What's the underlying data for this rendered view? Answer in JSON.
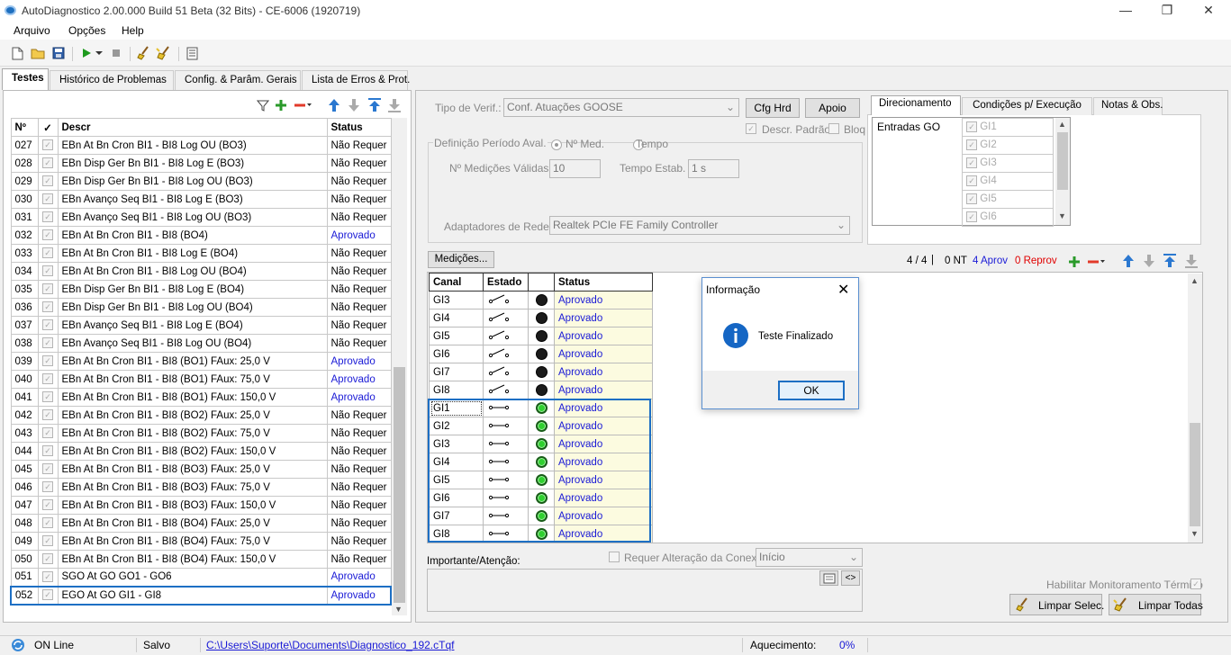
{
  "window": {
    "title": "AutoDiagnostico 2.00.000 Build 51 Beta (32 Bits) - CE-6006 (1920719)"
  },
  "menu": [
    "Arquivo",
    "Opções",
    "Help"
  ],
  "tabs": [
    "Testes",
    "Histórico de Problemas",
    "Config. & Parâm. Gerais",
    "Lista de Erros & Prot."
  ],
  "tests_table": {
    "headers": [
      "Nº",
      "✓",
      "Descr",
      "Status"
    ],
    "rows": [
      {
        "num": "027",
        "descr": "EBn At Bn Cron BI1 - BI8 Log OU (BO3)",
        "status": "Não Requer"
      },
      {
        "num": "028",
        "descr": "EBn Disp Ger Bn BI1 - BI8 Log E (BO3)",
        "status": "Não Requer"
      },
      {
        "num": "029",
        "descr": "EBn Disp Ger Bn BI1 - BI8 Log OU (BO3)",
        "status": "Não Requer"
      },
      {
        "num": "030",
        "descr": "EBn Avanço Seq BI1 - BI8 Log E (BO3)",
        "status": "Não Requer"
      },
      {
        "num": "031",
        "descr": "EBn Avanço Seq BI1 - BI8 Log OU (BO3)",
        "status": "Não Requer"
      },
      {
        "num": "032",
        "descr": "EBn At Bn Cron BI1 - BI8 (BO4)",
        "status": "Aprovado"
      },
      {
        "num": "033",
        "descr": "EBn At Bn Cron BI1 - BI8 Log E (BO4)",
        "status": "Não Requer"
      },
      {
        "num": "034",
        "descr": "EBn At Bn Cron BI1 - BI8 Log OU (BO4)",
        "status": "Não Requer"
      },
      {
        "num": "035",
        "descr": "EBn Disp Ger Bn BI1 - BI8 Log E (BO4)",
        "status": "Não Requer"
      },
      {
        "num": "036",
        "descr": "EBn Disp Ger Bn BI1 - BI8 Log OU (BO4)",
        "status": "Não Requer"
      },
      {
        "num": "037",
        "descr": "EBn Avanço Seq BI1 - BI8 Log E (BO4)",
        "status": "Não Requer"
      },
      {
        "num": "038",
        "descr": "EBn Avanço Seq BI1 - BI8 Log OU (BO4)",
        "status": "Não Requer"
      },
      {
        "num": "039",
        "descr": "EBn At Bn Cron BI1 - BI8 (BO1) FAux: 25,0 V",
        "status": "Aprovado"
      },
      {
        "num": "040",
        "descr": "EBn At Bn Cron BI1 - BI8 (BO1) FAux: 75,0 V",
        "status": "Aprovado"
      },
      {
        "num": "041",
        "descr": "EBn At Bn Cron BI1 - BI8 (BO1) FAux: 150,0 V",
        "status": "Aprovado"
      },
      {
        "num": "042",
        "descr": "EBn At Bn Cron BI1 - BI8 (BO2) FAux: 25,0 V",
        "status": "Não Requer"
      },
      {
        "num": "043",
        "descr": "EBn At Bn Cron BI1 - BI8 (BO2) FAux: 75,0 V",
        "status": "Não Requer"
      },
      {
        "num": "044",
        "descr": "EBn At Bn Cron BI1 - BI8 (BO2) FAux: 150,0 V",
        "status": "Não Requer"
      },
      {
        "num": "045",
        "descr": "EBn At Bn Cron BI1 - BI8 (BO3) FAux: 25,0 V",
        "status": "Não Requer"
      },
      {
        "num": "046",
        "descr": "EBn At Bn Cron BI1 - BI8 (BO3) FAux: 75,0 V",
        "status": "Não Requer"
      },
      {
        "num": "047",
        "descr": "EBn At Bn Cron BI1 - BI8 (BO3) FAux: 150,0 V",
        "status": "Não Requer"
      },
      {
        "num": "048",
        "descr": "EBn At Bn Cron BI1 - BI8 (BO4) FAux: 25,0 V",
        "status": "Não Requer"
      },
      {
        "num": "049",
        "descr": "EBn At Bn Cron BI1 - BI8 (BO4) FAux: 75,0 V",
        "status": "Não Requer"
      },
      {
        "num": "050",
        "descr": "EBn At Bn Cron BI1 - BI8 (BO4) FAux: 150,0 V",
        "status": "Não Requer"
      },
      {
        "num": "051",
        "descr": "SGO At GO GO1 - GO6",
        "status": "Aprovado"
      },
      {
        "num": "052",
        "descr": "EGO At GO GI1 - GI8",
        "status": "Aprovado"
      }
    ]
  },
  "config": {
    "tipo_label": "Tipo de Verif.:",
    "tipo_value": "Conf. Atuações GOOSE",
    "cfg_hrd": "Cfg Hrd",
    "apoio": "Apoio",
    "descr_padrao": "Descr. Padrão",
    "bloq": "Bloq",
    "periodo_label": "Definição Período Aval.",
    "radio_med": "Nº Med.",
    "radio_tempo": "Tempo",
    "medicoes_validas_label": "Nº Medições Válidas:",
    "medicoes_validas_value": "10",
    "tempo_estab_label": "Tempo Estab.",
    "tempo_estab_value": "1 s",
    "adaptadores_label": "Adaptadores de Rede:",
    "adaptadores_value": "Realtek PCIe FE Family Controller"
  },
  "right_tabs": [
    "Direcionamento",
    "Condições p/ Execução",
    "Notas & Obs."
  ],
  "direcionamento": {
    "label": "Entradas GO",
    "items": [
      "GI1",
      "GI2",
      "GI3",
      "GI4",
      "GI5",
      "GI6"
    ]
  },
  "medicoes": {
    "button": "Medições...",
    "counter": "4 / 4",
    "nt": "0 NT",
    "aprov": "4 Aprov",
    "reprov": "0 Reprov"
  },
  "channel_table": {
    "headers": [
      "Canal",
      "Estado",
      "",
      "Status"
    ],
    "rows": [
      {
        "canal": "GI3",
        "state": "off",
        "status": "Aprovado"
      },
      {
        "canal": "GI4",
        "state": "off",
        "status": "Aprovado"
      },
      {
        "canal": "GI5",
        "state": "off",
        "status": "Aprovado"
      },
      {
        "canal": "GI6",
        "state": "off",
        "status": "Aprovado"
      },
      {
        "canal": "GI7",
        "state": "off",
        "status": "Aprovado"
      },
      {
        "canal": "GI8",
        "state": "off",
        "status": "Aprovado"
      },
      {
        "canal": "GI1",
        "state": "on",
        "status": "Aprovado"
      },
      {
        "canal": "GI2",
        "state": "on",
        "status": "Aprovado"
      },
      {
        "canal": "GI3",
        "state": "on",
        "status": "Aprovado"
      },
      {
        "canal": "GI4",
        "state": "on",
        "status": "Aprovado"
      },
      {
        "canal": "GI5",
        "state": "on",
        "status": "Aprovado"
      },
      {
        "canal": "GI6",
        "state": "on",
        "status": "Aprovado"
      },
      {
        "canal": "GI7",
        "state": "on",
        "status": "Aprovado"
      },
      {
        "canal": "GI8",
        "state": "on",
        "status": "Aprovado"
      }
    ]
  },
  "bottom": {
    "requer_alteracao": "Requer Alteração da Conexão",
    "inicio": "Início",
    "importante": "Importante/Atenção:",
    "habilitar": "Habilitar Monitoramento Térmico",
    "limpar_selec": "Limpar Selec.",
    "limpar_todas": "Limpar Todas",
    "code_btn": "<>"
  },
  "dialog": {
    "title": "Informação",
    "message": "Teste Finalizado",
    "ok": "OK"
  },
  "status": {
    "online": "ON Line",
    "salvo": "Salvo",
    "path": "C:\\Users\\Suporte\\Documents\\Diagnostico_192.cTqf",
    "aquecimento_label": "Aquecimento:",
    "aquecimento_value": "0%"
  },
  "colors": {
    "accent": "#1d6fc4",
    "approved": "#1a1ad6",
    "reprov": "#e00000",
    "led_on": "#30d030"
  }
}
